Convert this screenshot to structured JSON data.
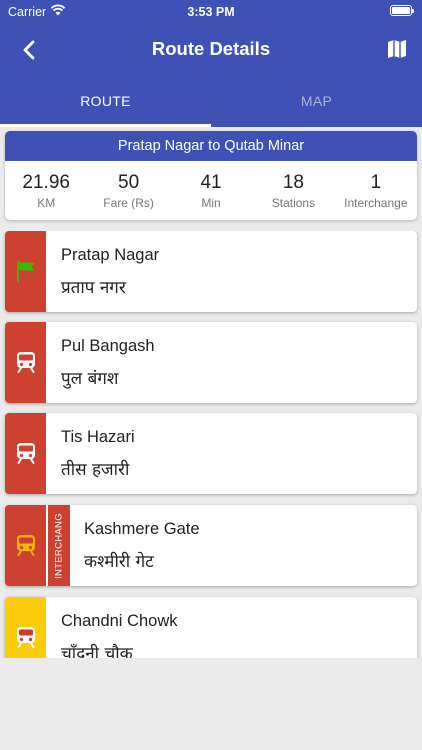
{
  "status": {
    "carrier": "Carrier",
    "time": "3:53 PM"
  },
  "nav": {
    "title": "Route Details",
    "back_icon": "chevron-left-icon",
    "map_icon": "map-icon"
  },
  "tabs": [
    {
      "label": "ROUTE",
      "active": true
    },
    {
      "label": "MAP",
      "active": false
    }
  ],
  "summary": {
    "route": "Pratap Nagar to Qutab Minar",
    "stats": [
      {
        "value": "21.96",
        "label": "KM"
      },
      {
        "value": "50",
        "label": "Fare (Rs)"
      },
      {
        "value": "41",
        "label": "Min"
      },
      {
        "value": "18",
        "label": "Stations"
      },
      {
        "value": "1",
        "label": "Interchange"
      }
    ]
  },
  "stations": [
    {
      "name": "Pratap Nagar",
      "hindi": "प्रताप नगर",
      "icon": "flag-icon",
      "line_color": "#cd4131"
    },
    {
      "name": "Pul Bangash",
      "hindi": "पुल बंगश",
      "icon": "metro-train-icon",
      "line_color": "#cd4131"
    },
    {
      "name": "Tis Hazari",
      "hindi": "तीस हजारी",
      "icon": "metro-train-icon",
      "line_color": "#cd4131"
    },
    {
      "name": "Kashmere Gate",
      "hindi": "कश्मीरी गेट",
      "icon": "metro-train-icon",
      "line_color": "#cd4131",
      "interchange_label": "INTERCHANG"
    },
    {
      "name": "Chandni Chowk",
      "hindi": "चाँदनी चौक",
      "icon": "metro-train-icon",
      "line_color": "#fccc0a"
    }
  ],
  "colors": {
    "primary": "#3f51b5",
    "red_line": "#cd4131",
    "yellow_line": "#fccc0a",
    "flag": "#3bb800",
    "train_white": "#ffffff",
    "train_yellow_on_red": "#f5b400",
    "train_red_on_yellow": "#d0362a"
  }
}
